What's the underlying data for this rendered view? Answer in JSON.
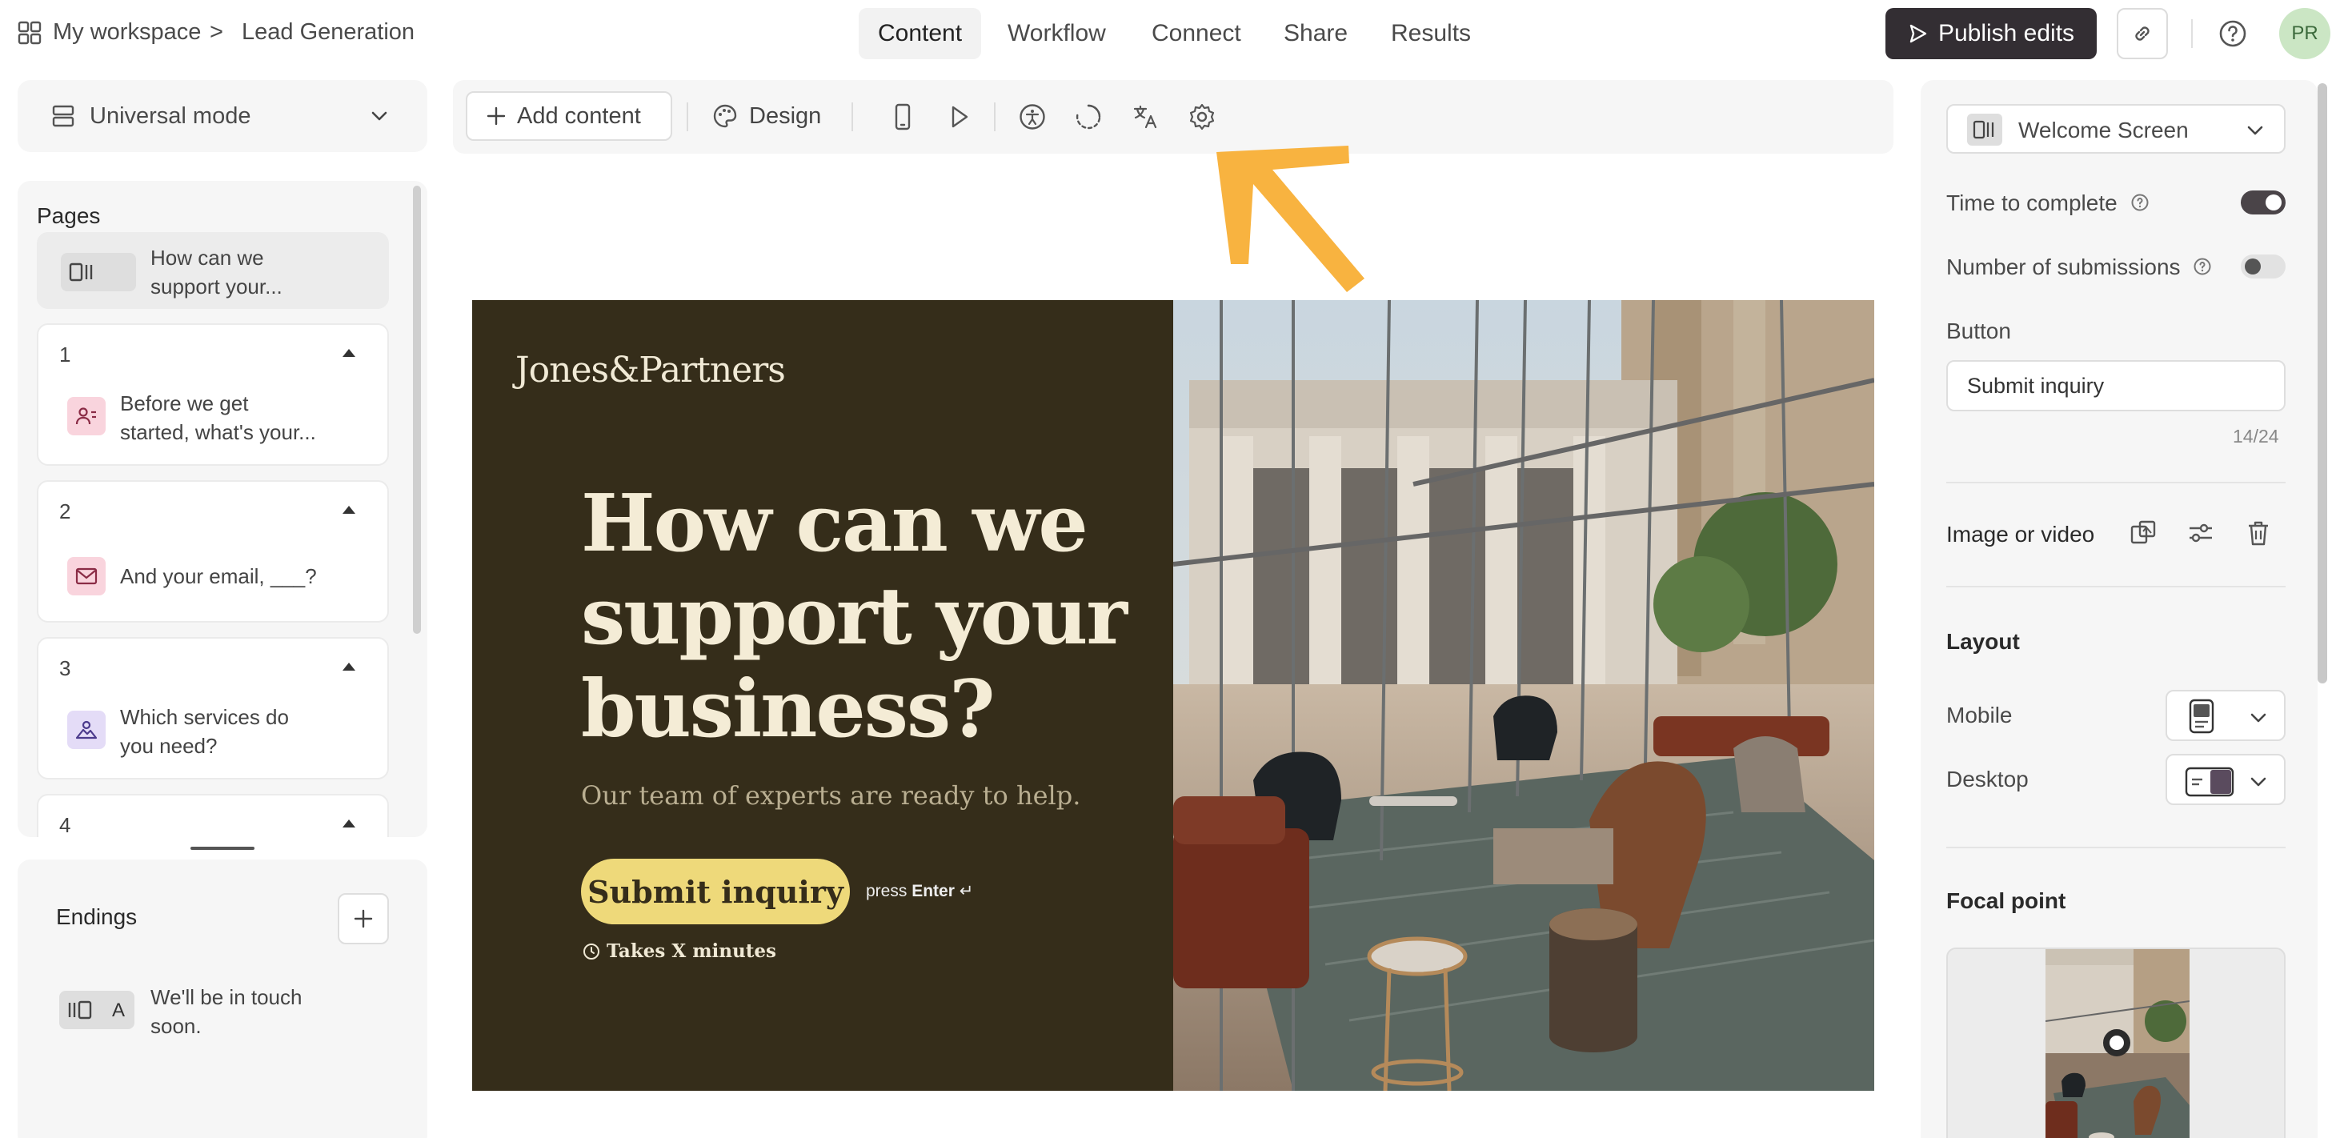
{
  "breadcrumb": {
    "workspace": "My workspace",
    "separator": ">",
    "page": "Lead Generation"
  },
  "nav_tabs": [
    "Content",
    "Workflow",
    "Connect",
    "Share",
    "Results"
  ],
  "publish_label": "Publish edits",
  "avatar_initials": "PR",
  "mode_select": {
    "label": "Universal mode"
  },
  "pages": {
    "title": "Pages",
    "welcome_text_1": "How can we",
    "welcome_text_2": "support your...",
    "items": [
      {
        "num": "1",
        "line1": "Before we get",
        "line2": "started, what's your...",
        "icon": "contact-icon",
        "color": "#f9d4dd"
      },
      {
        "num": "2",
        "line1": "And your email, ___?",
        "line2": "",
        "icon": "mail-icon",
        "color": "#f9d4dd"
      },
      {
        "num": "3",
        "line1": "Which services do",
        "line2": "you need?",
        "icon": "image-choice-icon",
        "color": "#e4dcf7"
      },
      {
        "num": "4",
        "line1": "",
        "line2": "",
        "icon": "",
        "color": ""
      }
    ]
  },
  "endings": {
    "title": "Endings",
    "badge": "A",
    "line1": "We'll be in touch",
    "line2": "soon."
  },
  "toolbar": {
    "add_content": "Add content",
    "design": "Design"
  },
  "preview": {
    "brand": "Jones&Partners",
    "title": "How can we support your business?",
    "subtitle": "Our team of experts are ready to help.",
    "cta": "Submit inquiry",
    "press": "press",
    "enter": "Enter",
    "takes": "Takes X minutes"
  },
  "settings": {
    "screen_select": "Welcome Screen",
    "time_to_complete": "Time to complete",
    "time_to_complete_on": true,
    "number_of_submissions": "Number of submissions",
    "number_of_submissions_on": false,
    "button_label": "Button",
    "button_value": "Submit inquiry",
    "char_count": "14/24",
    "image_or_video": "Image or video",
    "layout_title": "Layout",
    "mobile": "Mobile",
    "desktop": "Desktop",
    "focal_point": "Focal point"
  },
  "colors": {
    "accent_dark": "#332e33",
    "preview_bg": "#352d1a",
    "cta_yellow": "#eed97a",
    "arrow_orange": "#f8b340"
  }
}
